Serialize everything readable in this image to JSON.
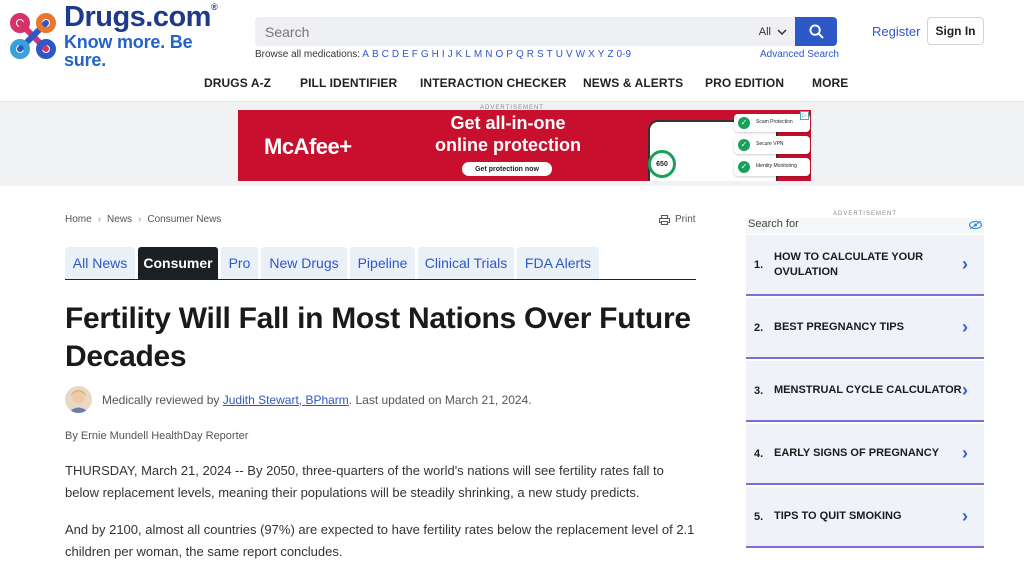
{
  "header": {
    "logo_name": "Drugs.com",
    "logo_trademark": "®",
    "logo_tagline": "Know more. Be sure.",
    "search_placeholder": "Search",
    "search_scope": "All",
    "browse_label": "Browse all medications:",
    "browse_letters": [
      "A",
      "B",
      "C",
      "D",
      "E",
      "F",
      "G",
      "H",
      "I",
      "J",
      "K",
      "L",
      "M",
      "N",
      "O",
      "P",
      "Q",
      "R",
      "S",
      "T",
      "U",
      "V",
      "W",
      "X",
      "Y",
      "Z",
      "0-9"
    ],
    "advanced_search": "Advanced Search",
    "register": "Register",
    "sign_in": "Sign In"
  },
  "nav": [
    "DRUGS A-Z",
    "PILL IDENTIFIER",
    "INTERACTION CHECKER",
    "NEWS & ALERTS",
    "PRO EDITION",
    "MORE"
  ],
  "ad_banner": {
    "label": "ADVERTISEMENT",
    "brand": "McAfee+",
    "headline_1": "Get all-in-one",
    "headline_2": "online protection",
    "cta": "Get protection now",
    "score": "650",
    "features": [
      "Scam Protection",
      "Secure VPN",
      "Identity Monitoring"
    ]
  },
  "breadcrumb": [
    "Home",
    "News",
    "Consumer News"
  ],
  "print_label": "Print",
  "tabs": [
    "All News",
    "Consumer",
    "Pro",
    "New Drugs",
    "Pipeline",
    "Clinical Trials",
    "FDA Alerts"
  ],
  "active_tab": "Consumer",
  "article": {
    "title": "Fertility Will Fall in Most Nations Over Future Decades",
    "review_prefix": "Medically reviewed by",
    "reviewer": "Judith Stewart, BPharm",
    "review_suffix": ". Last updated on March 21, 2024.",
    "byline": "By Ernie Mundell HealthDay Reporter",
    "paragraphs": [
      "THURSDAY, March 21, 2024 -- By 2050, three-quarters of the world's nations will see fertility rates fall to below replacement levels, meaning their populations will be steadily shrinking, a new study predicts.",
      "And by 2100, almost all countries (97%) are expected to have fertility rates below the replacement level of 2.1 children per woman, the same report concludes."
    ]
  },
  "sidebar": {
    "ad_label": "ADVERTISEMENT",
    "search_for": "Search for",
    "items": [
      {
        "num": "1.",
        "text": "How to Calculate Your Ovulation"
      },
      {
        "num": "2.",
        "text": "Best Pregnancy Tips"
      },
      {
        "num": "3.",
        "text": "Menstrual Cycle Calculator"
      },
      {
        "num": "4.",
        "text": "Early Signs of Pregnancy"
      },
      {
        "num": "5.",
        "text": "Tips to Quit Smoking"
      }
    ]
  }
}
